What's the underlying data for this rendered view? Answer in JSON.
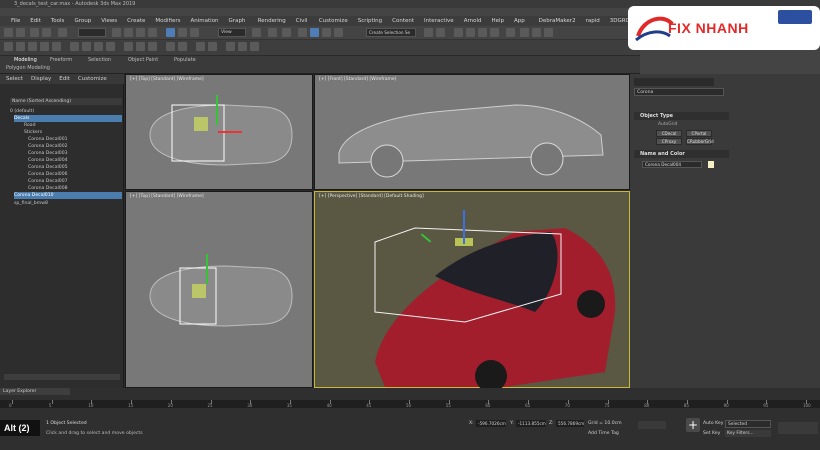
{
  "window": {
    "title": "3_decals_test_car.max - Autodesk 3ds Max 2019"
  },
  "menu": [
    "File",
    "Edit",
    "Tools",
    "Group",
    "Views",
    "Create",
    "Modifiers",
    "Animation",
    "Graph Editors",
    "Rendering",
    "Civil View",
    "Customize",
    "Scripting",
    "Content",
    "Interactive",
    "Arnold",
    "Help",
    "App Store",
    "DebraMaker2",
    "rapid Tools",
    "3DGROUND"
  ],
  "workspace": {
    "label": "Workspaces:",
    "value": "Default"
  },
  "toolbar": {
    "view_dropdown": "View",
    "selection_set": "Create Selection Se"
  },
  "ribbon": {
    "tabs": [
      "Modeling",
      "Freeform",
      "Selection",
      "Object Paint",
      "Populate"
    ],
    "subtab": "Polygon Modeling"
  },
  "scene_explorer": {
    "menu": [
      "Select",
      "Display",
      "Edit",
      "Customize"
    ],
    "column": "Name (Sorted Ascending)",
    "rows": [
      "0 (default)",
      "Decals",
      "Road",
      "Stickers",
      "Corona Decal001",
      "Corona Decal002",
      "Corona Decal003",
      "Corona Decal004",
      "Corona Decal005",
      "Corona Decal006",
      "Corona Decal007",
      "Corona Decal008",
      "Corona Decal009",
      "Corona Decal010",
      "sp_final_bmw8"
    ]
  },
  "viewports": {
    "top": "[+] [Top] [Standard] [Wireframe]",
    "front": "[+] [Front] [Standard] [Wireframe]",
    "left": "[+] [Top] [Standard] [Wireframe]",
    "persp": "[+] [Perspective] [Standard] [Default Shading]"
  },
  "command_panel": {
    "dropdown": "Corona",
    "object_type_title": "Object Type",
    "autogrid": "AutoGrid",
    "buttons": [
      "CDecal",
      "CPortal",
      "CProxy",
      "CRubberGrid"
    ],
    "name_color_title": "Name and Color",
    "name_value": "Corona Decal004"
  },
  "status": {
    "layer_explorer": "Layer Explorer",
    "frame": "0 / 100",
    "object_selected": "1 Object Selected",
    "hint": "Click and drag to select and move objects",
    "alt_badge": "Alt (2)",
    "x_label": "X:",
    "x_val": "-596.7026cm",
    "y_label": "Y:",
    "y_val": "-1113.855cm",
    "z_label": "Z:",
    "z_val": "556.7869cm",
    "grid": "Grid = 10.0cm",
    "add_time_tag": "Add Time Tag",
    "auto_key": "Auto Key",
    "set_key": "Set Key",
    "selected": "Selected",
    "key_filters": "Key Filters..."
  },
  "timeline": {
    "ticks": [
      0,
      5,
      10,
      15,
      20,
      25,
      30,
      35,
      40,
      45,
      50,
      55,
      60,
      65,
      70,
      75,
      80,
      85,
      90,
      95,
      100
    ]
  },
  "brand": {
    "accent": "#e02a2a",
    "text": "FIX NHANH"
  }
}
